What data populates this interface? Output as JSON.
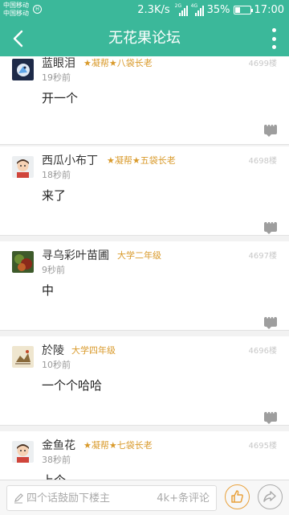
{
  "status_bar": {
    "carrier1": "中国移动",
    "carrier2": "中国移动",
    "hd": "H",
    "net_speed": "2.3K/s",
    "sim1_tag": "2G",
    "sim2_tag": "4G",
    "battery": "35%",
    "battery_level": 0.35,
    "time": "17:00"
  },
  "app_bar": {
    "title": "无花果论坛",
    "back_icon": "back-arrow-icon",
    "more_icon": "more-vertical-icon"
  },
  "posts": [
    {
      "user": "蓝眼泪",
      "rank": "★凝帮★八袋长老",
      "time": "19秒前",
      "floor": "4699楼",
      "content": "开一个",
      "avatar": "avatar-blue-bird"
    },
    {
      "user": "西瓜小布丁",
      "rank": "★凝帮★五袋长老",
      "time": "18秒前",
      "floor": "4698楼",
      "content": "来了",
      "avatar": "avatar-boy"
    },
    {
      "user": "寻乌彩叶苗圃",
      "rank": "大学二年级",
      "time": "9秒前",
      "floor": "4697楼",
      "content": "中",
      "avatar": "avatar-plant"
    },
    {
      "user": "於陵",
      "rank": "大学四年级",
      "time": "10秒前",
      "floor": "4696楼",
      "content": "一个个哈哈",
      "avatar": "avatar-painting"
    },
    {
      "user": "金鱼花",
      "rank": "★凝帮★七袋长老",
      "time": "38秒前",
      "floor": "4695楼",
      "content": "上个",
      "avatar": "avatar-boy"
    }
  ],
  "bottom_bar": {
    "placeholder": "四个话鼓励下楼主",
    "comment_count": "4k+条评论",
    "like_icon": "thumbs-up-icon",
    "share_icon": "share-icon"
  },
  "colors": {
    "primary": "#3bb89a",
    "rank": "#d99a2b",
    "like": "#e9a13b"
  }
}
